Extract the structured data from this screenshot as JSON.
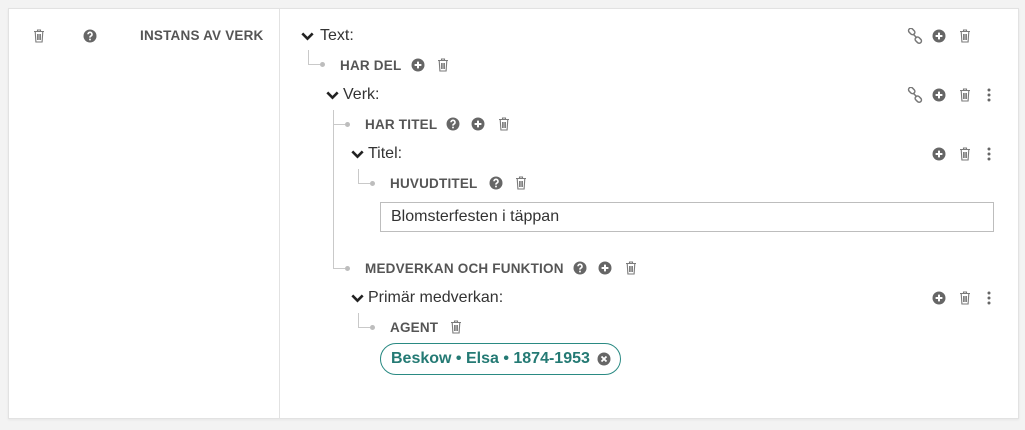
{
  "left": {
    "label": "INSTANS AV VERK",
    "icons": [
      "trash-icon",
      "help-icon"
    ]
  },
  "text_entity": {
    "title": "Text:",
    "property": "HAR DEL",
    "icons": [
      "link-icon",
      "plus-circle-icon",
      "trash-icon"
    ]
  },
  "work_entity": {
    "title": "Verk:",
    "icons": [
      "link-icon",
      "plus-circle-icon",
      "trash-icon",
      "more-vertical-icon"
    ],
    "title_property": "HAR TITEL",
    "contribution_property": "MEDVERKAN OCH FUNKTION"
  },
  "title_entity": {
    "title": "Titel:",
    "property": "HUVUDTITEL",
    "value": "Blomsterfesten i täppan",
    "icons": [
      "plus-circle-icon",
      "trash-icon",
      "more-vertical-icon"
    ]
  },
  "primary_contribution": {
    "title": "Primär medverkan:",
    "property": "AGENT",
    "agent_chip": "Beskow • Elsa • 1874-1953",
    "icons": [
      "plus-circle-icon",
      "trash-icon",
      "more-vertical-icon"
    ]
  },
  "colors": {
    "icon_gray": "#6f6f6f",
    "tree_line": "#c9c9c9",
    "chip_accent": "#2a8a83"
  }
}
